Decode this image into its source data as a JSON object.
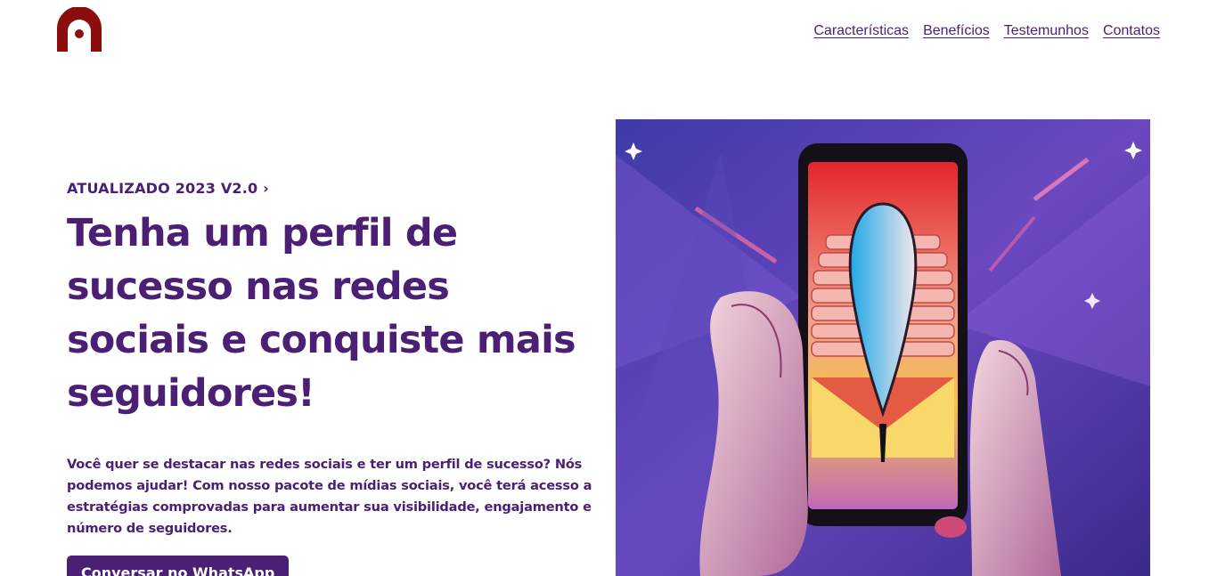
{
  "brand": {
    "logo_icon": "logo-arch-icon",
    "color": "#8b0d0d"
  },
  "nav": {
    "items": [
      {
        "label": "Características"
      },
      {
        "label": "Benefícios"
      },
      {
        "label": "Testemunhos"
      },
      {
        "label": "Contatos"
      }
    ]
  },
  "hero": {
    "eyebrow": "ATUALIZADO 2023 V2.0 ›",
    "title": "Tenha um perfil de sucesso nas redes sociais e conquiste mais seguidores!",
    "description": "Você quer se destacar nas redes sociais e ter um perfil de sucesso? Nós podemos ajudar! Com nosso pacote de mídias sociais, você terá acesso a estratégias comprovadas para aumentar sua visibilidade, engajamento e número de seguidores.",
    "cta_label": "Conversar no WhatsApp",
    "image_icon": "phone-in-hands-illustration"
  },
  "colors": {
    "primary": "#4a1f74",
    "background": "#ffffff"
  }
}
